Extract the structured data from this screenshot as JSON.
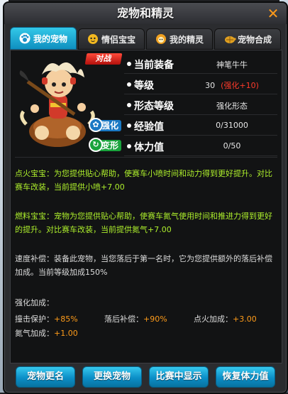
{
  "window": {
    "title": "宠物和精灵",
    "close_glyph": "✕"
  },
  "tabs": [
    {
      "label": "我的宠物",
      "icon": "paw-icon",
      "active": true
    },
    {
      "label": "情侣宝宝",
      "icon": "baby-face-icon",
      "active": false
    },
    {
      "label": "我的精灵",
      "icon": "sprite-face-icon",
      "active": false
    },
    {
      "label": "宠物合成",
      "icon": "turtle-icon",
      "active": false
    }
  ],
  "pet": {
    "battle_label": "对战",
    "strengthen_label": "强化",
    "transform_label": "变形"
  },
  "stats": {
    "equip": {
      "label": "当前装备",
      "value": "神笔牛牛"
    },
    "level": {
      "label": "等级",
      "value": "30",
      "bonus": "(强化+10)"
    },
    "form": {
      "label": "形态等级",
      "value": "强化形态"
    },
    "exp": {
      "label": "经验值",
      "value": "0/31000"
    },
    "stamina": {
      "label": "体力值",
      "value": "0/50"
    }
  },
  "skills": {
    "ignite": "点火宝宝：为您提供贴心帮助，使赛车小喷时间和动力得到更好提升。对比赛车改装，当前提供小喷+7.00",
    "fuel": "燃料宝宝：宠物为您提供贴心帮助，使赛车氮气使用时间和推进力得到更好的提升。对比赛车改装，当前提供氮气+7.00",
    "catchup": "速度补偿：装备此宠物，当您落后于第一名时，它为您提供额外的落后补偿加成。当前等级加成150%"
  },
  "bonus": {
    "title": "强化加成：",
    "collision": {
      "label": "撞击保护：",
      "value": "+85%"
    },
    "behind": {
      "label": "落后补偿：",
      "value": "+90%"
    },
    "ignite": {
      "label": "点火加成：",
      "value": "+3.00"
    },
    "nitro": {
      "label": "氮气加成：",
      "value": "+1.00"
    }
  },
  "footer": {
    "rename": "宠物更名",
    "switch": "更换宠物",
    "show_in_race": "比赛中显示",
    "restore": "恢复体力值"
  },
  "colors": {
    "accent": "#1aa6d8",
    "skill_text": "#aef02c",
    "bonus_value": "#ff9c1a",
    "close": "#ff9a1a"
  }
}
